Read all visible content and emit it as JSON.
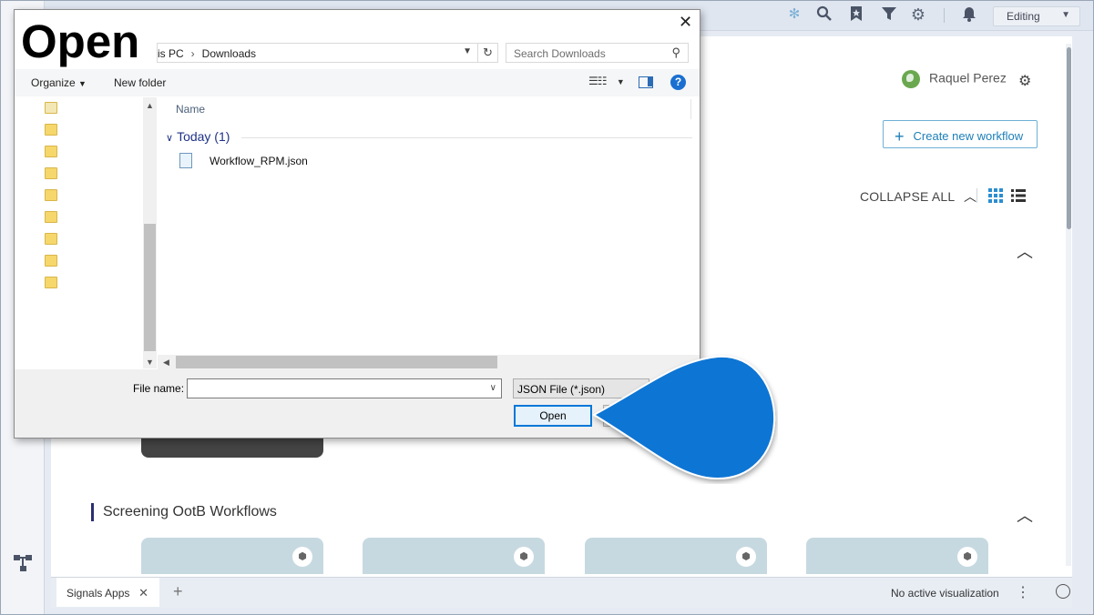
{
  "topbar": {
    "icons": [
      "settings-dots-icon",
      "search-icon",
      "bookmark-star-icon",
      "filter-icon",
      "gear-icon",
      "bell-icon"
    ],
    "mode_select": "Editing"
  },
  "main": {
    "user_name": "Raquel Perez",
    "create_workflow_label": "Create new workflow",
    "collapse_all_label": "COLLAPSE ALL",
    "section_title": "Screening OotB Workflows"
  },
  "bottom_bar": {
    "tab_label": "Signals Apps",
    "status_text": "No active visualization"
  },
  "dialog": {
    "title": "Open",
    "breadcrumb": [
      "is PC",
      "Downloads"
    ],
    "search_placeholder": "Search Downloads",
    "organize_label": "Organize",
    "new_folder_label": "New folder",
    "column_name": "Name",
    "group_label": "Today (1)",
    "files": [
      "Workflow_RPM.json"
    ],
    "file_name_label": "File name:",
    "file_name_value": "",
    "file_type_filter": "JSON File (*.json)",
    "open_button_label": "Open"
  },
  "colors": {
    "accent": "#0078d7",
    "callout": "#0a74d4",
    "section_marker": "#2a2f6e",
    "create_button": "#1c7fb8"
  }
}
